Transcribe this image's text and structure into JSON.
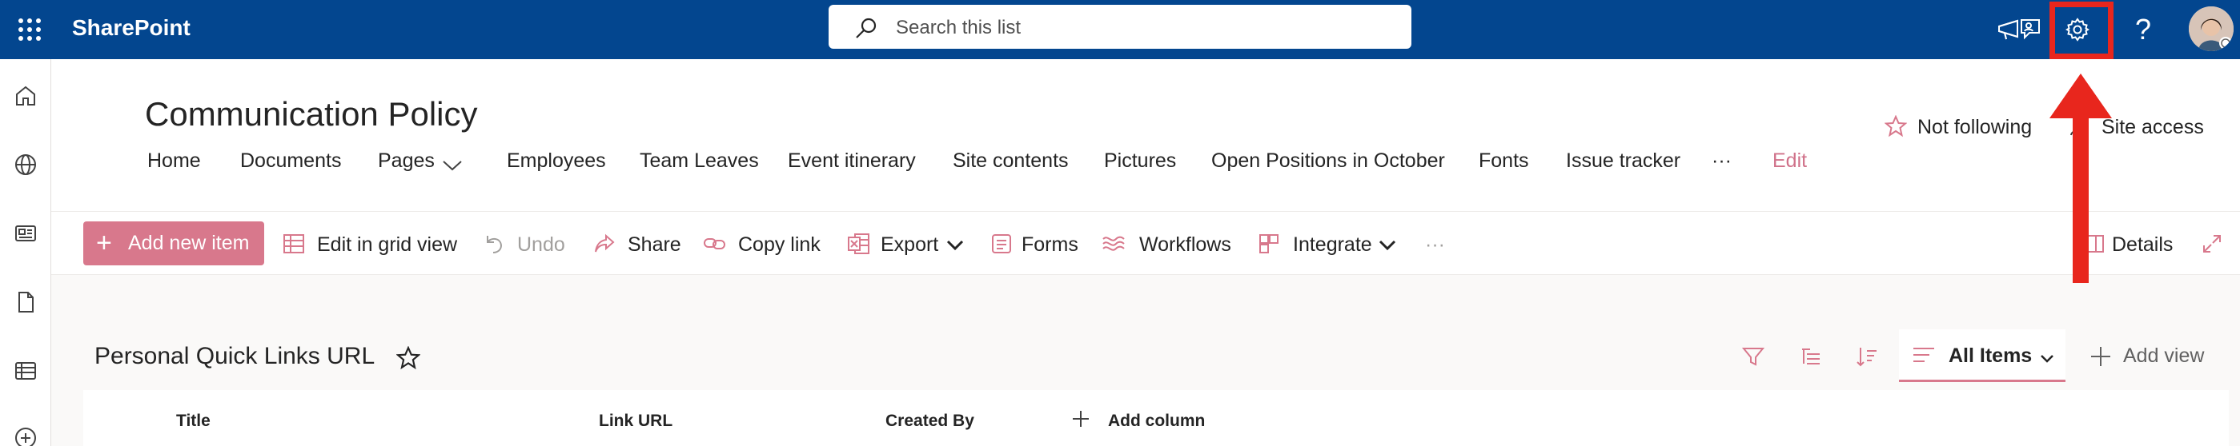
{
  "suite": {
    "app_name": "SharePoint",
    "search_placeholder": "Search this list",
    "help_glyph": "?"
  },
  "site": {
    "title": "Communication Policy",
    "nav": [
      "Home",
      "Documents",
      "Pages",
      "Employees",
      "Team Leaves",
      "Event itinerary",
      "Site contents",
      "Pictures",
      "Open Positions in October",
      "Fonts",
      "Issue tracker",
      "···",
      "Edit"
    ],
    "follow_label": "Not following",
    "access_label": "Site access"
  },
  "commands": {
    "add_new_item": "Add new item",
    "edit_grid": "Edit in grid view",
    "undo": "Undo",
    "share": "Share",
    "copy_link": "Copy link",
    "export": "Export",
    "forms": "Forms",
    "workflows": "Workflows",
    "integrate": "Integrate",
    "more": "···",
    "details": "Details"
  },
  "list": {
    "title": "Personal Quick Links URL",
    "view_name": "All Items",
    "add_view": "Add view",
    "columns": [
      "Title",
      "Link URL",
      "Created By"
    ],
    "add_column": "Add column"
  },
  "colors": {
    "suite_bar": "#03468f",
    "accent": "#d8788c",
    "annotation": "#e8261d"
  },
  "icons": [
    "waffle-icon",
    "search-icon",
    "megaphone-icon",
    "feedback-icon",
    "settings-gear-icon",
    "help-icon",
    "home-icon",
    "globe-icon",
    "news-icon",
    "document-icon",
    "list-icon",
    "add-circle-icon",
    "star-icon",
    "person-access-icon",
    "grid-icon",
    "undo-icon",
    "share-icon",
    "link-icon",
    "excel-export-icon",
    "forms-icon",
    "workflow-icon",
    "integrate-icon",
    "details-icon",
    "expand-icon",
    "filter-icon",
    "group-icon",
    "sort-icon",
    "view-lines-icon",
    "plus-icon",
    "chevron-down-icon"
  ]
}
